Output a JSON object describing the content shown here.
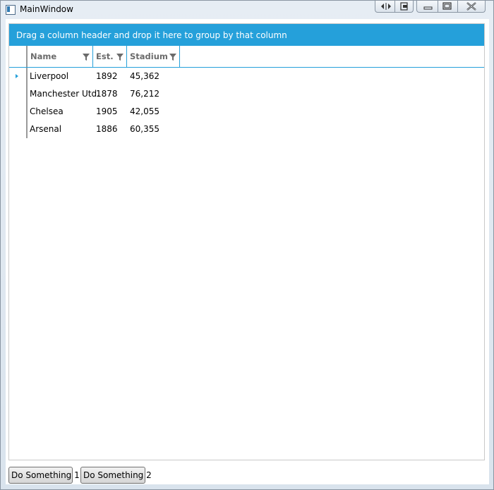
{
  "window": {
    "title": "MainWindow"
  },
  "caption_buttons": {
    "icons": [
      "split-icon",
      "restore-icon",
      "minimize-icon",
      "maximize-icon",
      "close-icon"
    ]
  },
  "grid": {
    "group_panel_text": "Drag a column header and drop it here to group by that column",
    "columns": [
      "Name",
      "Est.",
      "Stadium"
    ],
    "rows": [
      {
        "name": "Liverpool",
        "est": "1892",
        "stadium": "45,362"
      },
      {
        "name": "Manchester Utd.",
        "est": "1878",
        "stadium": "76,212"
      },
      {
        "name": "Chelsea",
        "est": "1905",
        "stadium": "42,055"
      },
      {
        "name": "Arsenal",
        "est": "1886",
        "stadium": "60,355"
      }
    ],
    "current_row_index": 0,
    "accent_color": "#25a0da"
  },
  "buttons": {
    "button1_label": "Do Something 1",
    "button2_label": "Do Something 2"
  }
}
